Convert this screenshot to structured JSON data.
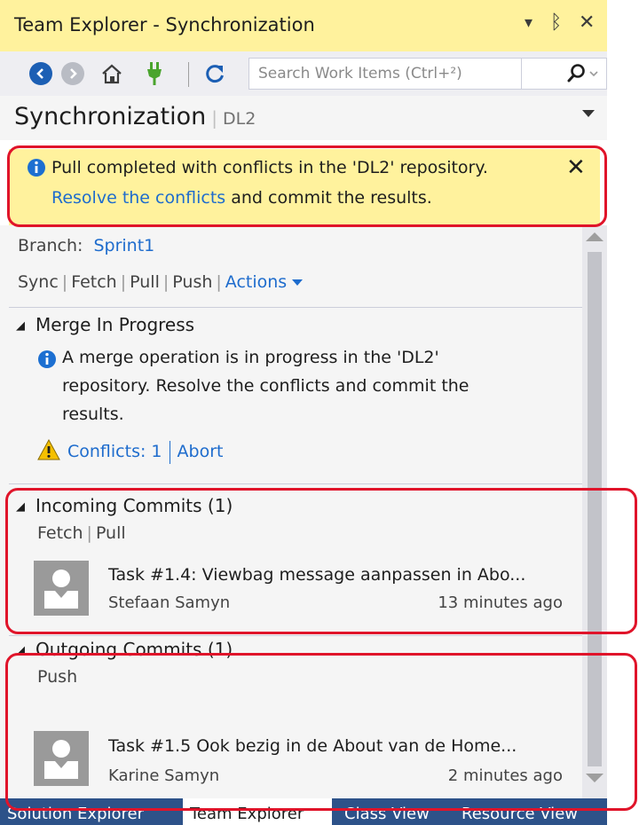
{
  "window": {
    "title": "Team Explorer - Synchronization",
    "dropdown_glyph": "▾",
    "pin_glyph": "ᛒ",
    "close_glyph": "✕"
  },
  "toolbar": {
    "search_placeholder": "Search Work Items (Ctrl+²)",
    "icons": [
      "back-icon",
      "forward-icon",
      "home-icon",
      "connect-icon",
      "refresh-icon",
      "search-icon"
    ]
  },
  "header": {
    "title": "Synchronization",
    "separator": "|",
    "repository": "DL2"
  },
  "notification": {
    "line1": "Pull completed with conflicts in the 'DL2' repository.",
    "link": "Resolve the conflicts",
    "line2_rest": " and commit the results.",
    "close": "✕"
  },
  "branch": {
    "label": "Branch:",
    "name": "Sprint1"
  },
  "actions": {
    "sync": "Sync",
    "fetch": "Fetch",
    "pull": "Pull",
    "push": "Push",
    "actions": "Actions"
  },
  "merge": {
    "title": "Merge In Progress",
    "message_line1": "A merge operation is in progress in the 'DL2'",
    "message_line2": "repository. Resolve the conflicts and commit the",
    "message_line3": "results.",
    "conflicts": "Conflicts: 1",
    "abort": "Abort"
  },
  "incoming": {
    "title": "Incoming Commits (1)",
    "fetch": "Fetch",
    "pull": "Pull",
    "commit_title": "Task #1.4: Viewbag message aanpassen in Abo...",
    "author": "Stefaan Samyn",
    "time": "13 minutes ago"
  },
  "outgoing": {
    "title": "Outgoing Commits (1)",
    "push": "Push",
    "commit_title": "Task #1.5 Ook bezig in de About van de Home...",
    "author": "Karine Samyn",
    "time": "2 minutes ago"
  },
  "tabs": [
    "Solution Explorer",
    "Team Explorer",
    "Class View",
    "Resource View"
  ],
  "colors": {
    "accent": "#1e6ccd",
    "notification_bg": "#fff29d",
    "tab_strip": "#2d5289",
    "annotation": "#e0142a"
  }
}
